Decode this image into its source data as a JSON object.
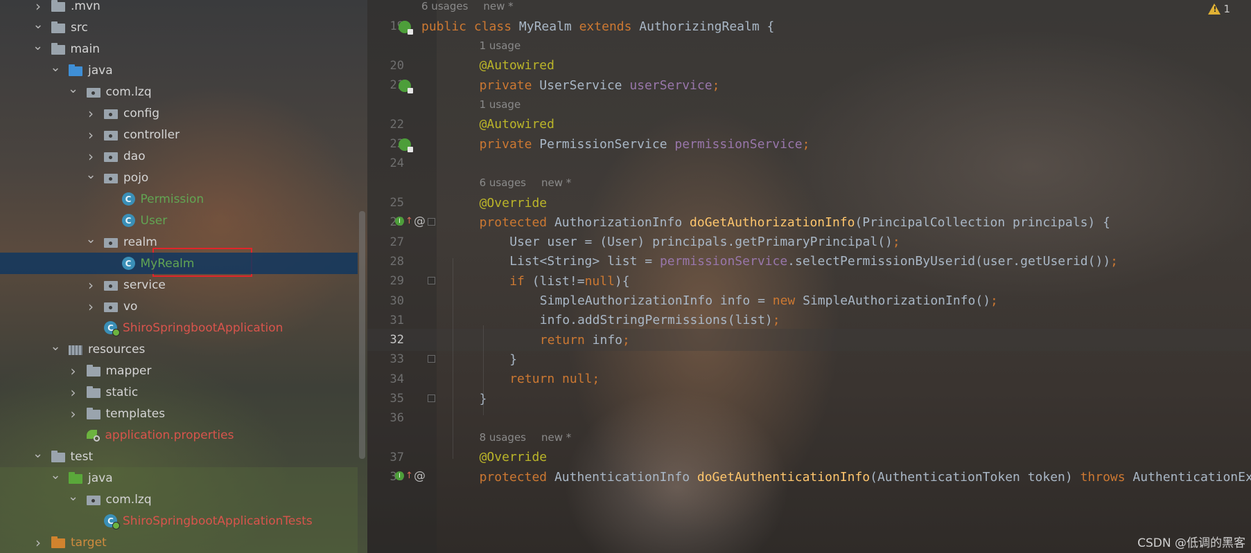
{
  "tree": {
    "items": [
      {
        "label": ".mvn",
        "depth": 1,
        "arrow": "right",
        "icon": "folder-icon",
        "tone": ""
      },
      {
        "label": "src",
        "depth": 1,
        "arrow": "down",
        "icon": "folder-icon",
        "tone": ""
      },
      {
        "label": "main",
        "depth": 2,
        "arrow": "down",
        "icon": "folder-icon",
        "tone": ""
      },
      {
        "label": "java",
        "depth": 3,
        "arrow": "down",
        "icon": "folder-blue-icon",
        "tone": ""
      },
      {
        "label": "com.lzq",
        "depth": 4,
        "arrow": "down",
        "icon": "package-icon",
        "tone": ""
      },
      {
        "label": "config",
        "depth": 5,
        "arrow": "right",
        "icon": "package-icon",
        "tone": ""
      },
      {
        "label": "controller",
        "depth": 5,
        "arrow": "right",
        "icon": "package-icon",
        "tone": ""
      },
      {
        "label": "dao",
        "depth": 5,
        "arrow": "right",
        "icon": "package-icon",
        "tone": ""
      },
      {
        "label": "pojo",
        "depth": 5,
        "arrow": "down",
        "icon": "package-icon",
        "tone": ""
      },
      {
        "label": "Permission",
        "depth": 6,
        "arrow": "none",
        "icon": "class-icon",
        "tone": "green"
      },
      {
        "label": "User",
        "depth": 6,
        "arrow": "none",
        "icon": "class-icon",
        "tone": "green"
      },
      {
        "label": "realm",
        "depth": 5,
        "arrow": "down",
        "icon": "package-icon",
        "tone": ""
      },
      {
        "label": "MyRealm",
        "depth": 6,
        "arrow": "none",
        "icon": "class-icon",
        "tone": "green",
        "selected": true
      },
      {
        "label": "service",
        "depth": 5,
        "arrow": "right",
        "icon": "package-icon",
        "tone": ""
      },
      {
        "label": "vo",
        "depth": 5,
        "arrow": "right",
        "icon": "package-icon",
        "tone": ""
      },
      {
        "label": "ShiroSpringbootApplication",
        "depth": 5,
        "arrow": "none",
        "icon": "spring-class-icon",
        "tone": "red"
      },
      {
        "label": "resources",
        "depth": 3,
        "arrow": "down",
        "icon": "resources-icon",
        "tone": ""
      },
      {
        "label": "mapper",
        "depth": 4,
        "arrow": "right",
        "icon": "folder-icon",
        "tone": ""
      },
      {
        "label": "static",
        "depth": 4,
        "arrow": "right",
        "icon": "folder-icon",
        "tone": ""
      },
      {
        "label": "templates",
        "depth": 4,
        "arrow": "right",
        "icon": "folder-icon",
        "tone": ""
      },
      {
        "label": "application.properties",
        "depth": 4,
        "arrow": "none",
        "icon": "properties-icon",
        "tone": "red"
      },
      {
        "label": "test",
        "depth": 2,
        "arrow": "down",
        "icon": "folder-icon",
        "tone": ""
      },
      {
        "label": "java",
        "depth": 3,
        "arrow": "down",
        "icon": "folder-green-icon",
        "tone": "",
        "band": true
      },
      {
        "label": "com.lzq",
        "depth": 4,
        "arrow": "down",
        "icon": "package-icon",
        "tone": "",
        "band": true
      },
      {
        "label": "ShiroSpringbootApplicationTests",
        "depth": 5,
        "arrow": "none",
        "icon": "spring-class-icon",
        "tone": "red",
        "band": true
      },
      {
        "label": "target",
        "depth": 1,
        "arrow": "right",
        "icon": "folder-orange-icon",
        "tone": "orange",
        "band": true
      }
    ]
  },
  "editor": {
    "warning_count": "1",
    "lines": [
      {
        "type": "hint",
        "usages": "6 usages",
        "new": "new *",
        "indent": 0
      },
      {
        "type": "code",
        "num": "19",
        "gutter": "bean",
        "indent": 0,
        "tokens": [
          [
            "kw",
            "public class "
          ],
          [
            "cls",
            "MyRealm "
          ],
          [
            "kw",
            "extends "
          ],
          [
            "cls",
            "AuthorizingRealm {"
          ]
        ]
      },
      {
        "type": "hint",
        "usages": "1 usage",
        "new": "",
        "indent": 1
      },
      {
        "type": "code",
        "num": "20",
        "gutter": "",
        "indent": 1,
        "tokens": [
          [
            "ann",
            "@Autowired"
          ]
        ]
      },
      {
        "type": "code",
        "num": "21",
        "gutter": "bean",
        "indent": 1,
        "tokens": [
          [
            "kw",
            "private "
          ],
          [
            "cls",
            "UserService "
          ],
          [
            "fld",
            "userService"
          ],
          [
            "semi",
            ";"
          ]
        ]
      },
      {
        "type": "hint",
        "usages": "1 usage",
        "new": "",
        "indent": 1
      },
      {
        "type": "code",
        "num": "22",
        "gutter": "",
        "indent": 1,
        "tokens": [
          [
            "ann",
            "@Autowired"
          ]
        ]
      },
      {
        "type": "code",
        "num": "23",
        "gutter": "bean",
        "indent": 1,
        "tokens": [
          [
            "kw",
            "private "
          ],
          [
            "cls",
            "PermissionService "
          ],
          [
            "fld",
            "permissionService"
          ],
          [
            "semi",
            ";"
          ]
        ]
      },
      {
        "type": "code",
        "num": "24",
        "gutter": "",
        "indent": 1,
        "tokens": []
      },
      {
        "type": "hint",
        "usages": "6 usages",
        "new": "new *",
        "indent": 1
      },
      {
        "type": "code",
        "num": "25",
        "gutter": "",
        "indent": 1,
        "tokens": [
          [
            "ann",
            "@Override"
          ]
        ]
      },
      {
        "type": "code",
        "num": "26",
        "gutter": "override",
        "fold": true,
        "indent": 1,
        "tokens": [
          [
            "kw",
            "protected "
          ],
          [
            "cls",
            "AuthorizationInfo "
          ],
          [
            "mth",
            "doGetAuthorizationInfo"
          ],
          [
            "txt",
            "(PrincipalCollection principals) {"
          ]
        ]
      },
      {
        "type": "code",
        "num": "27",
        "gutter": "",
        "indent": 2,
        "tokens": [
          [
            "txt",
            "User user = (User) principals.getPrimaryPrincipal()"
          ],
          [
            "semi",
            ";"
          ]
        ]
      },
      {
        "type": "code",
        "num": "28",
        "gutter": "",
        "indent": 2,
        "tokens": [
          [
            "txt",
            "List<String> list = "
          ],
          [
            "fld",
            "permissionService"
          ],
          [
            "txt",
            ".selectPermissionByUserid(user.getUserid())"
          ],
          [
            "semi",
            ";"
          ]
        ]
      },
      {
        "type": "code",
        "num": "29",
        "gutter": "",
        "fold": true,
        "indent": 2,
        "tokens": [
          [
            "kw",
            "if "
          ],
          [
            "txt",
            "(list!="
          ],
          [
            "kw",
            "null"
          ],
          [
            "txt",
            "){"
          ]
        ]
      },
      {
        "type": "code",
        "num": "30",
        "gutter": "",
        "indent": 3,
        "tokens": [
          [
            "txt",
            "SimpleAuthorizationInfo info = "
          ],
          [
            "kw",
            "new "
          ],
          [
            "txt",
            "SimpleAuthorizationInfo()"
          ],
          [
            "semi",
            ";"
          ]
        ]
      },
      {
        "type": "code",
        "num": "31",
        "gutter": "",
        "indent": 3,
        "tokens": [
          [
            "txt",
            "info.addStringPermissions(list)"
          ],
          [
            "semi",
            ";"
          ]
        ]
      },
      {
        "type": "code",
        "num": "32",
        "gutter": "",
        "indent": 3,
        "current": true,
        "tokens": [
          [
            "kw",
            "return "
          ],
          [
            "txt",
            "info"
          ],
          [
            "semi",
            ";"
          ]
        ]
      },
      {
        "type": "code",
        "num": "33",
        "gutter": "",
        "fold": true,
        "indent": 2,
        "tokens": [
          [
            "txt",
            "}"
          ]
        ]
      },
      {
        "type": "code",
        "num": "34",
        "gutter": "",
        "indent": 2,
        "tokens": [
          [
            "kw",
            "return null"
          ],
          [
            "semi",
            ";"
          ]
        ]
      },
      {
        "type": "code",
        "num": "35",
        "gutter": "",
        "fold": true,
        "indent": 1,
        "tokens": [
          [
            "txt",
            "}"
          ]
        ]
      },
      {
        "type": "code",
        "num": "36",
        "gutter": "",
        "indent": 1,
        "tokens": []
      },
      {
        "type": "hint",
        "usages": "8 usages",
        "new": "new *",
        "indent": 1
      },
      {
        "type": "code",
        "num": "37",
        "gutter": "",
        "indent": 1,
        "tokens": [
          [
            "ann",
            "@Override"
          ]
        ]
      },
      {
        "type": "code",
        "num": "38",
        "gutter": "override",
        "indent": 1,
        "tokens": [
          [
            "kw",
            "protected "
          ],
          [
            "cls",
            "AuthenticationInfo "
          ],
          [
            "mth",
            "doGetAuthenticationInfo"
          ],
          [
            "txt",
            "(AuthenticationToken token) "
          ],
          [
            "kw",
            "throws "
          ],
          [
            "txt",
            "AuthenticationException {"
          ]
        ]
      }
    ]
  },
  "watermark": "CSDN @低调的黑客"
}
